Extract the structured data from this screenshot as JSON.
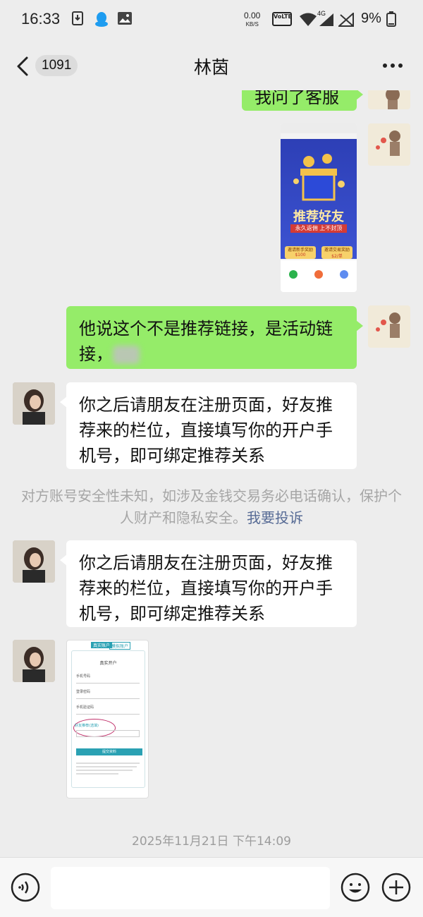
{
  "status_bar": {
    "time": "16:33",
    "net_speed_value": "0.00",
    "net_speed_unit": "KB/S",
    "volte": "VoLTE",
    "network": "4G",
    "battery": "9%"
  },
  "header": {
    "unread_count": "1091",
    "title": "林茵"
  },
  "messages": [
    {
      "sender": "me",
      "type": "text",
      "text": "我问了客服"
    },
    {
      "sender": "me",
      "type": "image",
      "image": {
        "banner_title": "推荐好友",
        "banner_sub": "永久返佣 上不封顶",
        "card_left_label": "邀请新手奖励",
        "card_left_value": "$100",
        "card_right_label": "邀请交易奖励",
        "card_right_value": "$2/单"
      }
    },
    {
      "sender": "me",
      "type": "text",
      "text": "他说这个不是推荐链接，是活动链接，"
    },
    {
      "sender": "peer",
      "type": "text",
      "text": "你之后请朋友在注册页面，好友推荐来的栏位，直接填写你的开户手机号，即可绑定推荐关系"
    },
    {
      "sender": "system",
      "type": "notice",
      "text": "对方账号安全性未知，如涉及金钱交易务必电话确认，保护个人财产和隐私安全。",
      "link": "我要投诉"
    },
    {
      "sender": "peer",
      "type": "text",
      "text": "你之后请朋友在注册页面，好友推荐来的栏位，直接填写你的开户手机号，即可绑定推荐关系"
    },
    {
      "sender": "peer",
      "type": "image",
      "image": {
        "tab_active": "真实账户",
        "tab_inactive": "模拟账户",
        "form_title": "真实开户",
        "field_1": "手机号码",
        "field_2": "登录密码",
        "field_3": "手机验证码",
        "referral_label": "好友推荐(选填)",
        "submit": "提交资料"
      }
    }
  ],
  "timestamp": "2025年11月21日 下午14:09",
  "input_bar": {
    "placeholder": ""
  },
  "colors": {
    "background": "#ededed",
    "bubble_me": "#95ec69",
    "bubble_peer": "#ffffff",
    "link": "#576b95"
  }
}
